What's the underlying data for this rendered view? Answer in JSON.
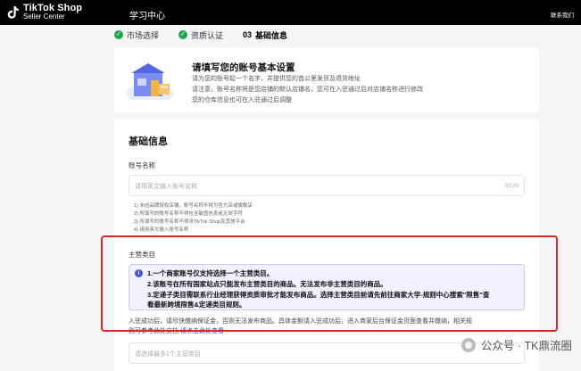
{
  "header": {
    "logo_title": "TikTok Shop",
    "logo_subtitle": "Seller Center",
    "nav_learn": "学习中心",
    "contact": "联系我们"
  },
  "steps": [
    {
      "label": "市场选择",
      "done": true
    },
    {
      "label": "资质认证",
      "done": true
    },
    {
      "num": "03",
      "label": "基础信息",
      "done": false
    }
  ],
  "info_card": {
    "title": "请填写您的账号基本设置",
    "lines": [
      "请为您的账号起一个名字，并提供您的首公里发货及退货地址",
      "请注意，账号名称将是您店铺的默认店铺名，您可在入驻通过后对店铺名称进行修改",
      "您的仓库信息也可在入驻通过后调整"
    ]
  },
  "form": {
    "section_title": "基础信息",
    "account_name_label": "账号名称",
    "account_name_placeholder": "请用英文输入账号名称",
    "account_name_count": "0/120",
    "hints": [
      "1) 未经品牌授权店铺，账号名称不得为官方店或旗舰店",
      "2) 所填写的账号名称不得包含敏感信息或无效字符",
      "3) 所填写的账号名称不得涉TikTok Shop及其他平台",
      "4) 请用英文输入账号名称"
    ],
    "category_label": "主营类目",
    "notice_lines": [
      "1.一个商家账号仅支持选择一个主营类目。",
      "2.该账号在所有国家站点只能发布主营类目的商品。无法发布非主营类目的商品。",
      "3.定递子类目需联系行业经理获得资质审批才能发布商品。选择主营类目前请先前往商家大学-规则中心搜索\"限售\"查",
      "看最新跨境限售&定递类目规则。"
    ],
    "after_line_1": "入驻成功后，请尽快缴纳保证金，否则无法发布商品。具体金额请入驻成功后，进入商家后台保证金页面查看并缴纳，相关规",
    "after_line_2": "则可参考此处文档",
    "after_link": "请点击此处查看",
    "select_placeholder": "请选择最多1个主营类目"
  },
  "watermark": "公众号 · TK鼎流圈"
}
